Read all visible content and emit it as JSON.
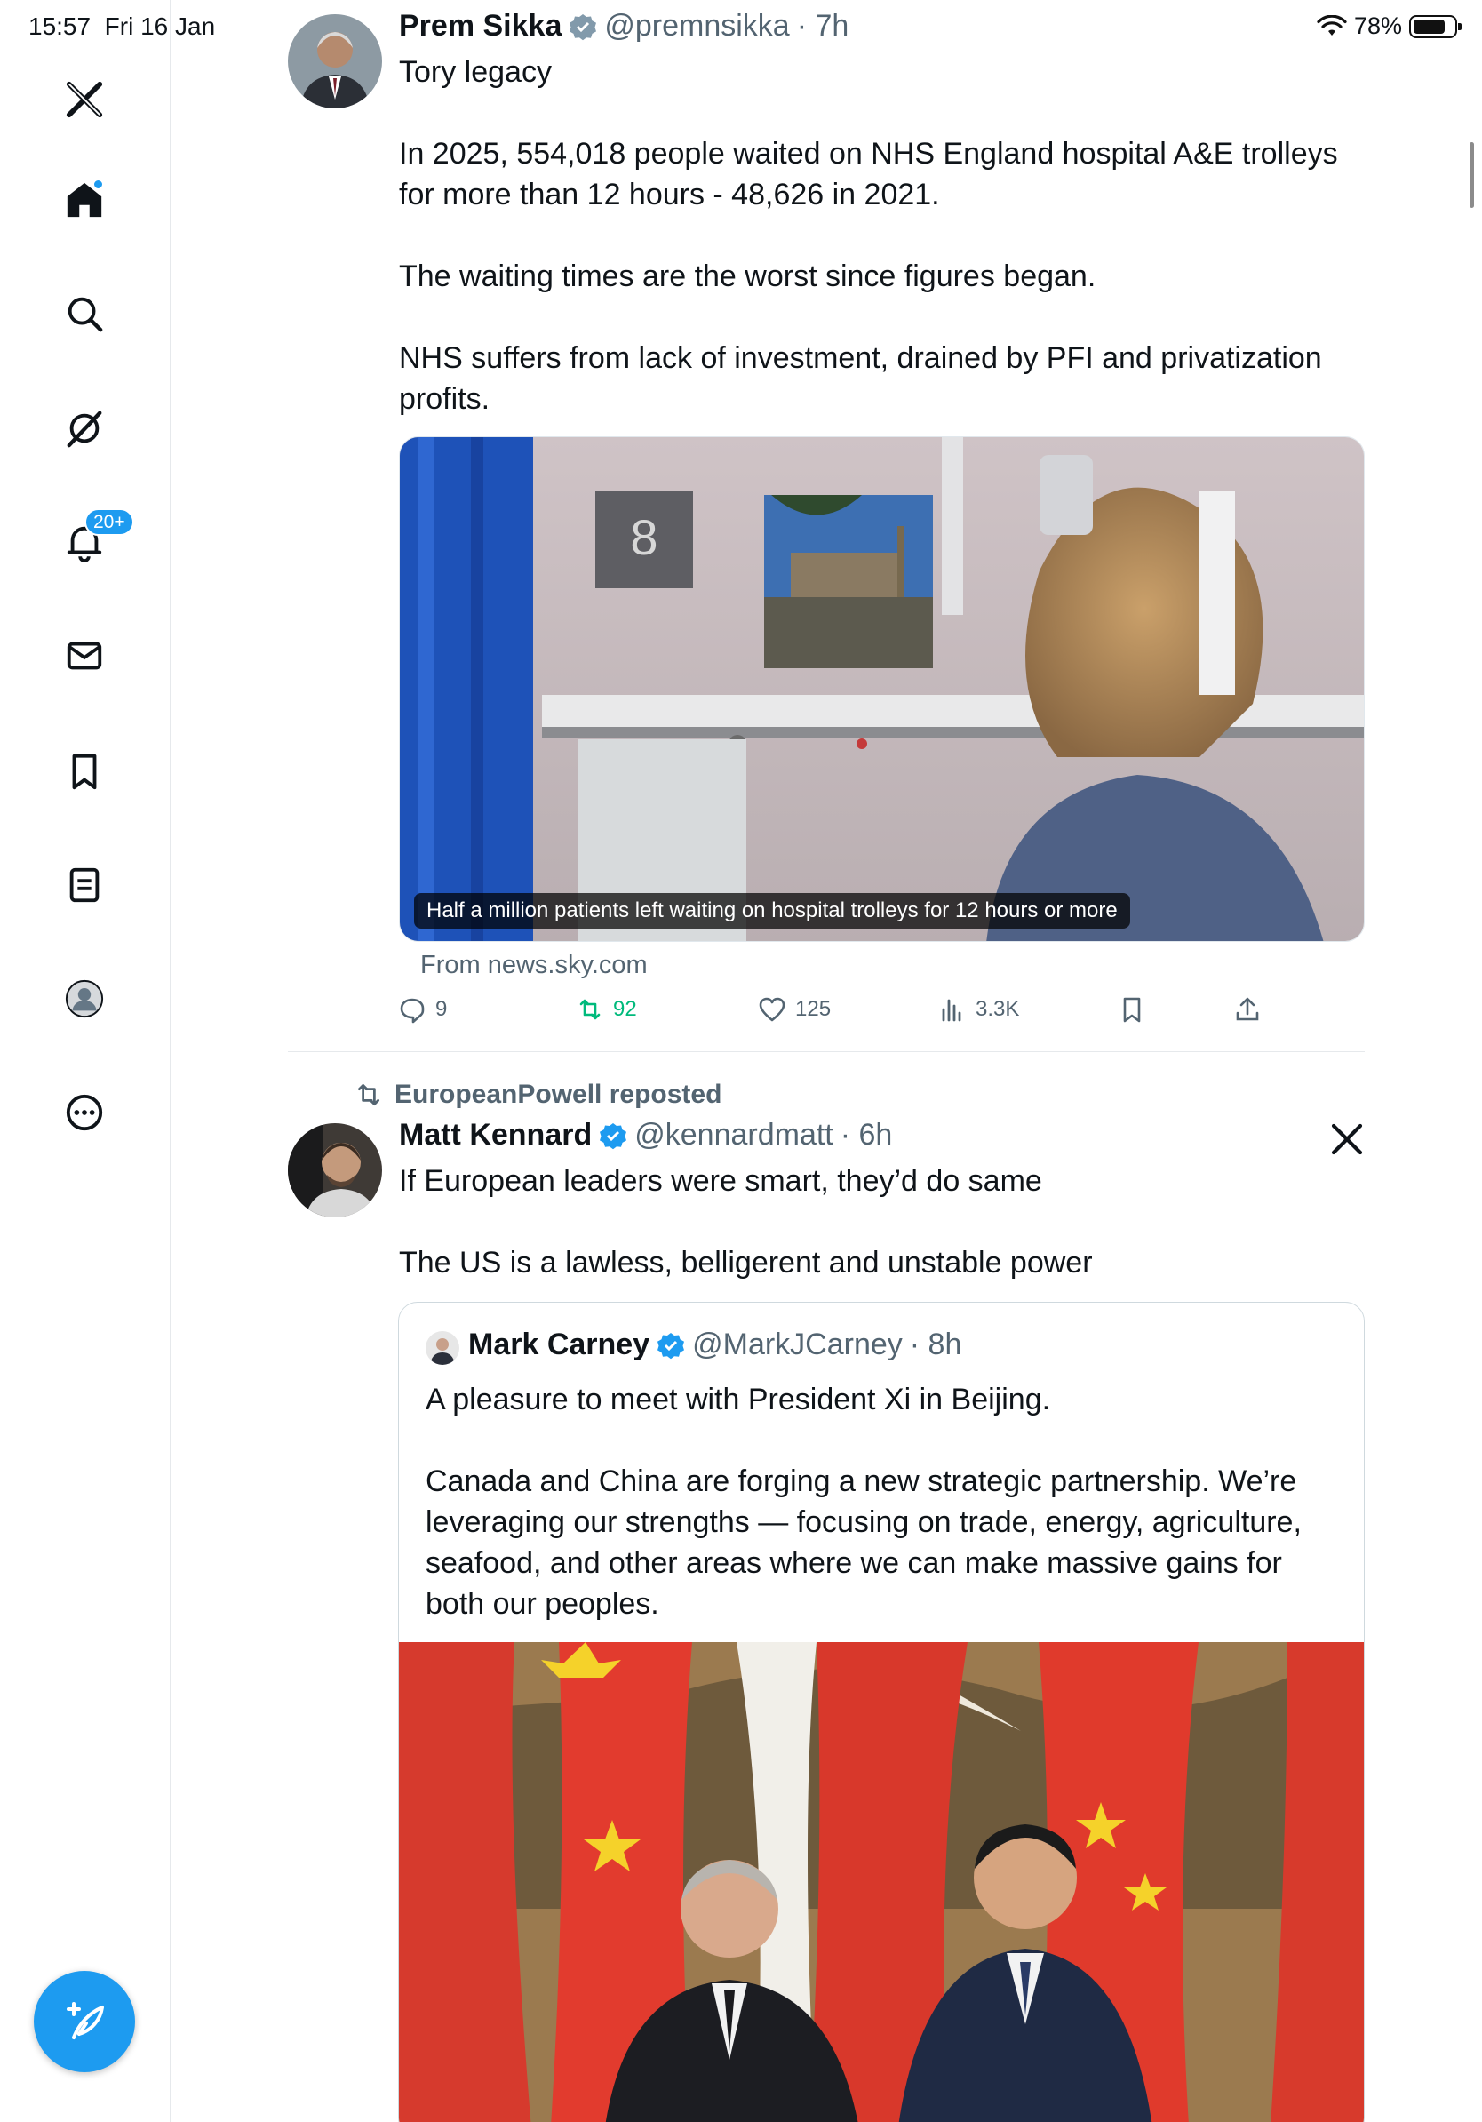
{
  "status_bar": {
    "time": "15:57",
    "date": "Fri 16 Jan",
    "battery": "78%"
  },
  "sidebar": {
    "items": [
      {
        "name": "x-logo-icon"
      },
      {
        "name": "home-icon",
        "active": true
      },
      {
        "name": "search-icon"
      },
      {
        "name": "grok-icon"
      },
      {
        "name": "notifications-icon",
        "badge": "20+"
      },
      {
        "name": "messages-icon"
      },
      {
        "name": "bookmarks-icon"
      },
      {
        "name": "lists-icon"
      },
      {
        "name": "profile-icon"
      },
      {
        "name": "more-icon"
      }
    ],
    "compose_icon": "compose-icon"
  },
  "tweet1": {
    "name": "Prem Sikka",
    "handle": "@premnsikka",
    "time": "· 7h",
    "text": "Tory legacy\n\nIn 2025, 554,018 people waited on NHS England hospital A&E trolleys for more than 12 hours - 48,626 in 2021.\n\nThe waiting times are the worst since figures began.\n\nNHS suffers from lack of investment, drained by PFI and privatization profits.",
    "card": {
      "caption": "Half a million patients left waiting on hospital trolleys for 12 hours or more",
      "bay_number": "8",
      "source": "From news.sky.com"
    },
    "stats": {
      "replies": "9",
      "reposts": "92",
      "likes": "125",
      "views": "3.3K"
    }
  },
  "repost": {
    "label": "EuropeanPowell reposted"
  },
  "tweet2": {
    "name": "Matt Kennard",
    "handle": "@kennardmatt",
    "time": "· 6h",
    "text": "If European leaders were smart, they’d do same\n\nThe US is a lawless, belligerent and unstable power",
    "quote": {
      "name": "Mark Carney",
      "handle": "@MarkJCarney",
      "time": "· 8h",
      "text": "A pleasure to meet with President Xi in Beijing.\n\nCanada and China are forging a new strategic partnership. We’re leveraging our strengths — focusing on trade, energy, agriculture, seafood, and other areas where we can make massive gains for both our peoples."
    }
  },
  "colors": {
    "accent": "#1d9bf0",
    "repost_green": "#00ba7c",
    "secondary_text": "#536471"
  }
}
